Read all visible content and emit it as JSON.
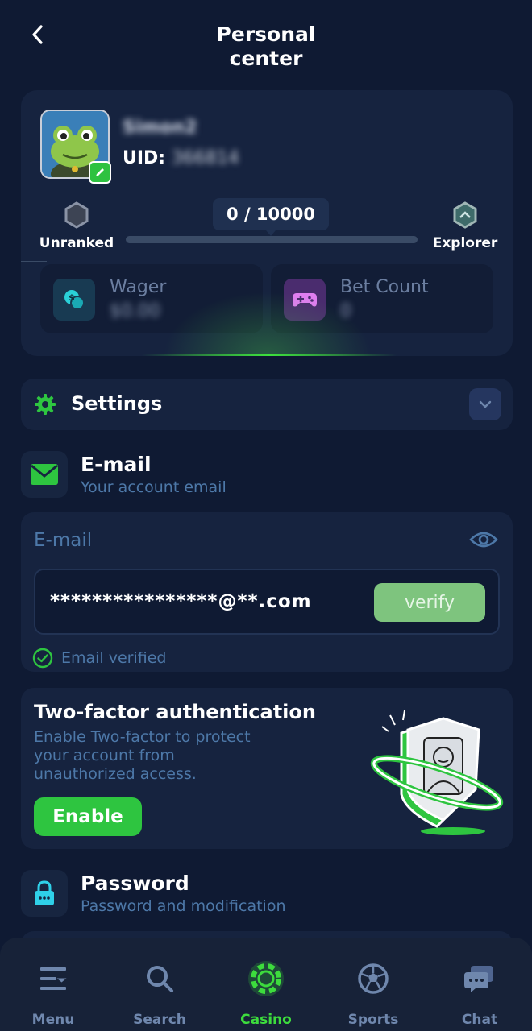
{
  "header": {
    "title": "Personal center"
  },
  "profile": {
    "username": "Simon2",
    "uid_label": "UID:",
    "uid_value": "366814",
    "rank_current": "Unranked",
    "rank_next": "Explorer",
    "progress_text": "0 / 10000",
    "progress_fraction": 0,
    "stats": {
      "wager_label": "Wager",
      "wager_value": "$0.00",
      "bet_count_label": "Bet Count",
      "bet_count_value": "0"
    }
  },
  "settings": {
    "label": "Settings"
  },
  "email_section": {
    "title": "E-mail",
    "subtitle": "Your account email",
    "field_label": "E-mail",
    "value": "****************@**.com",
    "verify_label": "verify",
    "verified_text": "Email verified"
  },
  "twofa": {
    "title": "Two-factor authentication",
    "description": "Enable Two-factor to protect your account from unauthorized access.",
    "enable_label": "Enable"
  },
  "password_section": {
    "title": "Password",
    "subtitle": "Password and modification"
  },
  "nav": {
    "items": [
      {
        "label": "Menu",
        "icon": "menu-icon"
      },
      {
        "label": "Search",
        "icon": "search-icon"
      },
      {
        "label": "Casino",
        "icon": "casino-chip-icon"
      },
      {
        "label": "Sports",
        "icon": "soccer-ball-icon"
      },
      {
        "label": "Chat",
        "icon": "chat-icon"
      }
    ],
    "active": "Casino"
  },
  "colors": {
    "background": "#0f1a33",
    "card": "#16233f",
    "accent_green": "#2ec540",
    "muted_blue": "#4d78a8"
  }
}
